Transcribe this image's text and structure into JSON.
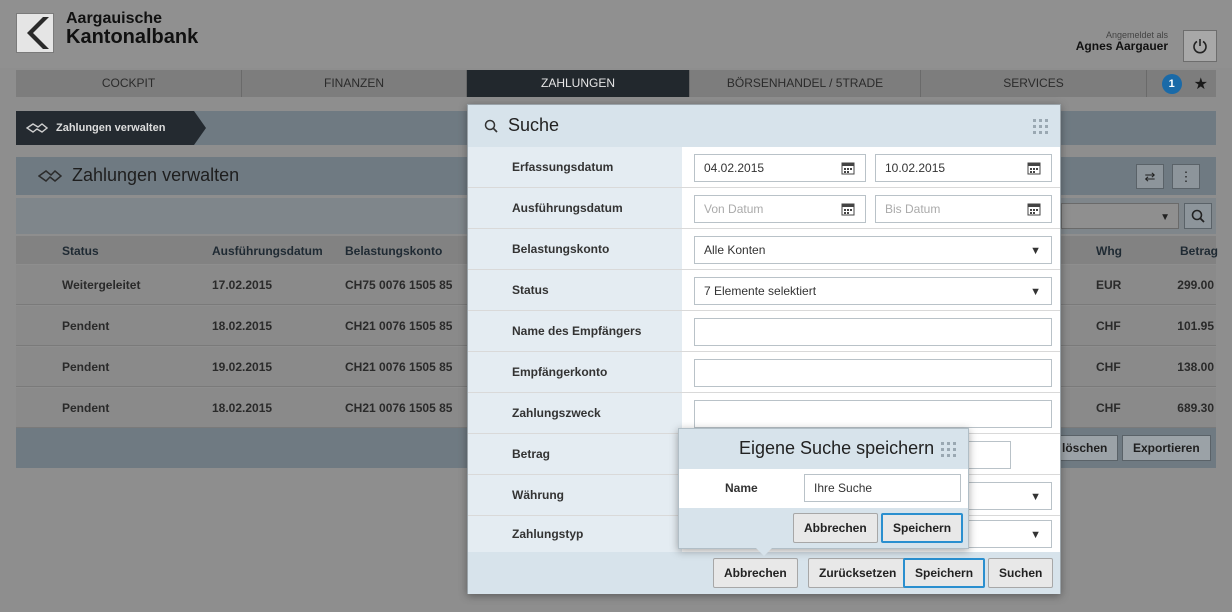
{
  "header": {
    "bank_line1": "Aargauische",
    "bank_line2": "Kantonalbank",
    "login_label": "Angemeldet als",
    "user_name": "Agnes Aargauer"
  },
  "nav": {
    "tabs": [
      {
        "label": "COCKPIT"
      },
      {
        "label": "FINANZEN"
      },
      {
        "label": "ZAHLUNGEN"
      },
      {
        "label": "BÖRSENHANDEL / 5TRADE"
      },
      {
        "label": "SERVICES"
      }
    ],
    "notification_count": "1"
  },
  "breadcrumb": {
    "label": "Zahlungen verwalten"
  },
  "panel": {
    "title": "Zahlungen verwalten",
    "columns": {
      "status": "Status",
      "exec_date": "Ausführungsdatum",
      "debit_account": "Belastungskonto",
      "currency": "Whg",
      "amount": "Betrag"
    },
    "rows": [
      {
        "status": "Weitergeleitet",
        "date": "17.02.2015",
        "account": "CH75 0076 1505 85",
        "currency": "EUR",
        "amount": "299.00"
      },
      {
        "status": "Pendent",
        "date": "18.02.2015",
        "account": "CH21 0076 1505 85",
        "currency": "CHF",
        "amount": "101.95"
      },
      {
        "status": "Pendent",
        "date": "19.02.2015",
        "account": "CH21 0076 1505 85",
        "currency": "CHF",
        "amount": "138.00"
      },
      {
        "status": "Pendent",
        "date": "18.02.2015",
        "account": "CH21 0076 1505 85",
        "currency": "CHF",
        "amount": "689.30"
      }
    ],
    "delete_label": "löschen",
    "export_label": "Exportieren"
  },
  "search_modal": {
    "title": "Suche",
    "fields": {
      "capture_date_label": "Erfassungsdatum",
      "capture_from": "04.02.2015",
      "capture_to": "10.02.2015",
      "exec_date_label": "Ausführungsdatum",
      "exec_from_placeholder": "Von Datum",
      "exec_to_placeholder": "Bis Datum",
      "debit_account_label": "Belastungskonto",
      "debit_account_value": "Alle Konten",
      "status_label": "Status",
      "status_value": "7 Elemente selektiert",
      "recipient_name_label": "Name des Empfängers",
      "recipient_account_label": "Empfängerkonto",
      "purpose_label": "Zahlungszweck",
      "amount_label": "Betrag",
      "currency_label": "Währung",
      "payment_type_label": "Zahlungstyp"
    },
    "buttons": {
      "cancel": "Abbrechen",
      "reset": "Zurücksetzen",
      "save": "Speichern",
      "search": "Suchen"
    }
  },
  "save_popover": {
    "title": "Eigene Suche speichern",
    "name_label": "Name",
    "name_value": "Ihre Suche",
    "cancel": "Abbrechen",
    "save": "Speichern"
  },
  "colors": {
    "nav_active": "#22282d",
    "modal_header": "#d7e3eb",
    "primary_border": "#2a8fcf",
    "badge": "#1a6aa8"
  }
}
